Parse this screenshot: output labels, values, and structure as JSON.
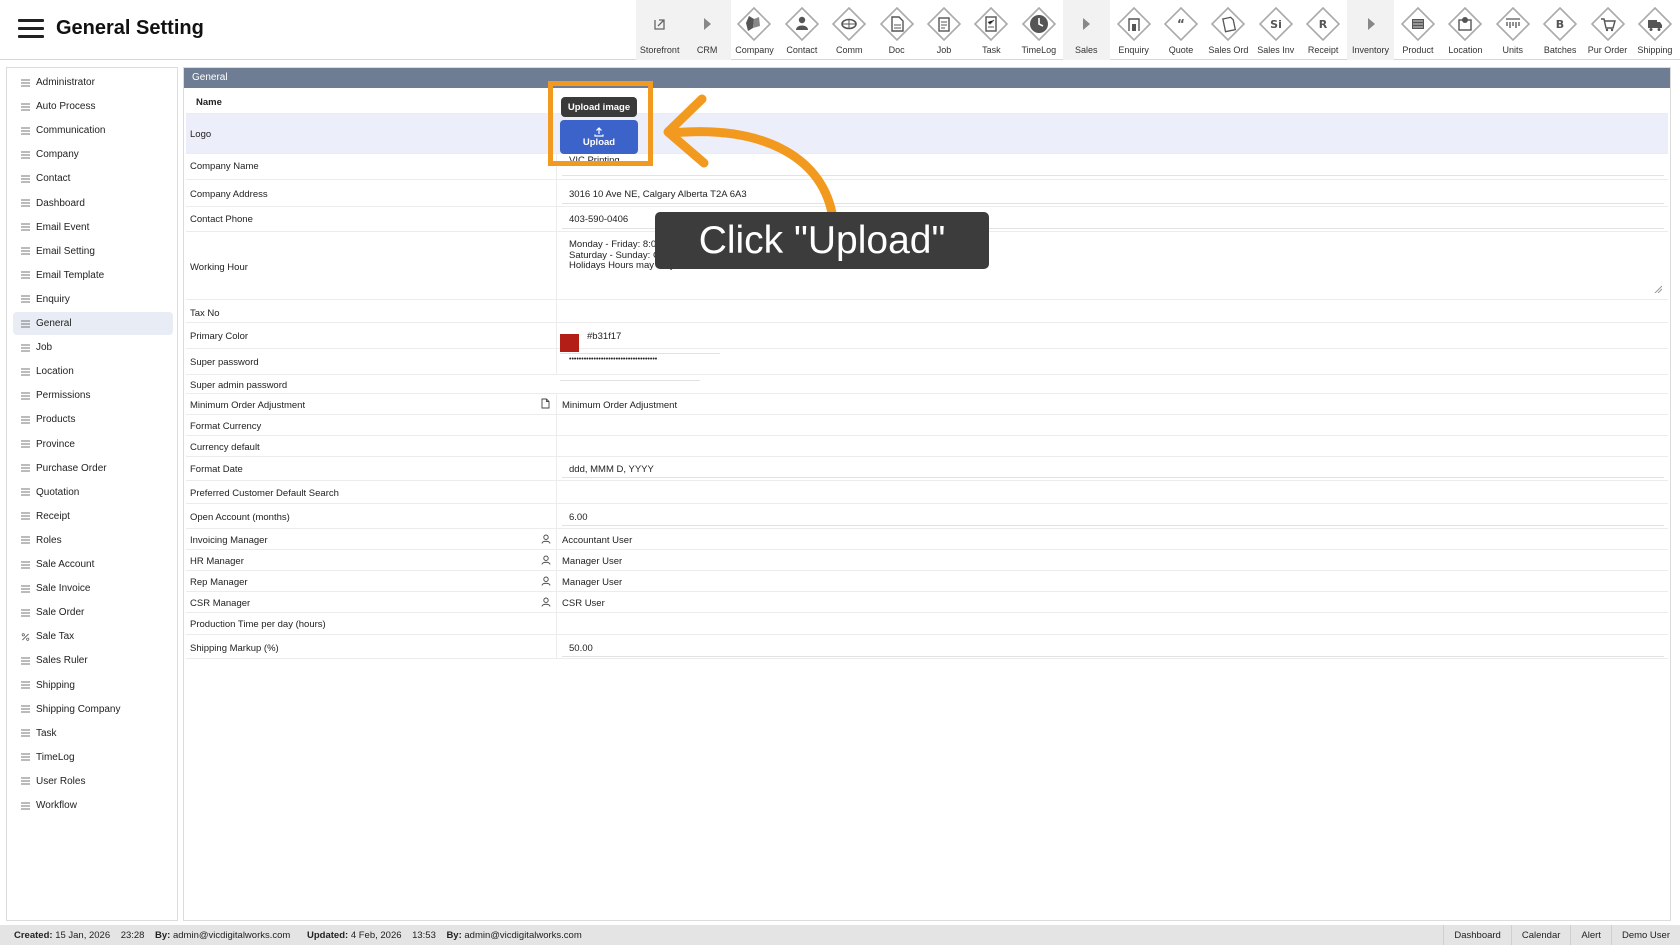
{
  "header": {
    "title": "General Setting"
  },
  "toolbar": [
    {
      "label": "Storefront",
      "icon": "external-link-icon",
      "shaded": true
    },
    {
      "label": "CRM",
      "icon": "chevron-right-icon",
      "shaded": true
    },
    {
      "label": "Company",
      "icon": "company-icon",
      "shaded": false
    },
    {
      "label": "Contact",
      "icon": "contact-icon",
      "shaded": false
    },
    {
      "label": "Comm",
      "icon": "comm-icon",
      "shaded": false
    },
    {
      "label": "Doc",
      "icon": "doc-icon",
      "shaded": false
    },
    {
      "label": "Job",
      "icon": "job-icon",
      "shaded": false
    },
    {
      "label": "Task",
      "icon": "task-icon",
      "shaded": false
    },
    {
      "label": "TimeLog",
      "icon": "clock-icon",
      "shaded": false
    },
    {
      "label": "Sales",
      "icon": "chevron-right-icon",
      "shaded": true
    },
    {
      "label": "Enquiry",
      "icon": "enquiry-icon",
      "shaded": false
    },
    {
      "label": "Quote",
      "icon": "quote-icon",
      "shaded": false
    },
    {
      "label": "Sales Ord",
      "icon": "sales-order-icon",
      "shaded": false
    },
    {
      "label": "Sales Inv",
      "icon": "sales-invoice-icon",
      "glyph": "Si",
      "shaded": false
    },
    {
      "label": "Receipt",
      "icon": "receipt-icon",
      "glyph": "R",
      "shaded": false
    },
    {
      "label": "Inventory",
      "icon": "chevron-right-icon",
      "shaded": true
    },
    {
      "label": "Product",
      "icon": "product-icon",
      "shaded": false
    },
    {
      "label": "Location",
      "icon": "location-icon",
      "shaded": false
    },
    {
      "label": "Units",
      "icon": "units-icon",
      "shaded": false
    },
    {
      "label": "Batches",
      "icon": "batches-icon",
      "glyph": "B",
      "shaded": false
    },
    {
      "label": "Pur Order",
      "icon": "cart-icon",
      "shaded": false
    },
    {
      "label": "Shipping",
      "icon": "truck-icon",
      "shaded": false
    }
  ],
  "sidebar": {
    "items": [
      {
        "label": "Administrator",
        "icon": "list-icon"
      },
      {
        "label": "Auto Process",
        "icon": "list-icon"
      },
      {
        "label": "Communication",
        "icon": "list-icon"
      },
      {
        "label": "Company",
        "icon": "list-icon"
      },
      {
        "label": "Contact",
        "icon": "list-icon"
      },
      {
        "label": "Dashboard",
        "icon": "list-icon"
      },
      {
        "label": "Email Event",
        "icon": "list-icon"
      },
      {
        "label": "Email Setting",
        "icon": "list-icon"
      },
      {
        "label": "Email Template",
        "icon": "list-icon"
      },
      {
        "label": "Enquiry",
        "icon": "list-icon"
      },
      {
        "label": "General",
        "icon": "list-icon",
        "active": true
      },
      {
        "label": "Job",
        "icon": "list-icon"
      },
      {
        "label": "Location",
        "icon": "list-icon"
      },
      {
        "label": "Permissions",
        "icon": "list-icon"
      },
      {
        "label": "Products",
        "icon": "list-icon"
      },
      {
        "label": "Province",
        "icon": "list-icon"
      },
      {
        "label": "Purchase Order",
        "icon": "list-icon"
      },
      {
        "label": "Quotation",
        "icon": "list-icon"
      },
      {
        "label": "Receipt",
        "icon": "list-icon"
      },
      {
        "label": "Roles",
        "icon": "list-icon"
      },
      {
        "label": "Sale Account",
        "icon": "list-icon"
      },
      {
        "label": "Sale Invoice",
        "icon": "list-icon"
      },
      {
        "label": "Sale Order",
        "icon": "list-icon"
      },
      {
        "label": "Sale Tax",
        "icon": "percent-icon"
      },
      {
        "label": "Sales Ruler",
        "icon": "list-icon"
      },
      {
        "label": "Shipping",
        "icon": "list-icon"
      },
      {
        "label": "Shipping Company",
        "icon": "list-icon"
      },
      {
        "label": "Task",
        "icon": "list-icon"
      },
      {
        "label": "TimeLog",
        "icon": "list-icon"
      },
      {
        "label": "User Roles",
        "icon": "list-icon"
      },
      {
        "label": "Workflow",
        "icon": "list-icon"
      }
    ]
  },
  "panel": {
    "title": "General",
    "fields": {
      "name": "Name",
      "logo": "Logo",
      "company_name": {
        "label": "Company Name",
        "value": "VIC Printing"
      },
      "company_address": {
        "label": "Company Address",
        "value": "3016 10 Ave NE, Calgary Alberta T2A 6A3"
      },
      "contact_phone": {
        "label": "Contact Phone",
        "value": "403-590-0406"
      },
      "working_hour": {
        "label": "Working Hour",
        "lines": [
          "Monday - Friday: 8:00AM - 05:00PM",
          "Saturday - Sunday: Closed",
          "Holidays Hours may vary"
        ]
      },
      "tax_no": {
        "label": "Tax No"
      },
      "primary_color": {
        "label": "Primary Color",
        "value": "#b31f17"
      },
      "super_password": {
        "label": "Super password",
        "value": "••••••••••••••••••••••••••••••••••••"
      },
      "super_admin_password": {
        "label": "Super admin password"
      },
      "min_order_adjustment": {
        "label": "Minimum Order Adjustment",
        "value": "Minimum Order Adjustment"
      },
      "format_currency": {
        "label": "Format Currency"
      },
      "currency_default": {
        "label": "Currency default"
      },
      "format_date": {
        "label": "Format Date",
        "value": "ddd, MMM D, YYYY"
      },
      "preferred_customer_search": {
        "label": "Preferred Customer Default Search"
      },
      "open_account": {
        "label": "Open Account (months)",
        "value": "6.00"
      },
      "invoicing_manager": {
        "label": "Invoicing Manager",
        "value": "Accountant User"
      },
      "hr_manager": {
        "label": "HR Manager",
        "value": "Manager User"
      },
      "rep_manager": {
        "label": "Rep Manager",
        "value": "Manager User"
      },
      "csr_manager": {
        "label": "CSR Manager",
        "value": "CSR User"
      },
      "production_time": {
        "label": "Production Time per day (hours)"
      },
      "shipping_markup": {
        "label": "Shipping Markup (%)",
        "value": "50.00"
      }
    },
    "upload": {
      "tooltip": "Upload image",
      "label": "Upload"
    }
  },
  "callout": {
    "text": "Click \"Upload\"",
    "accent": "#f29a1f"
  },
  "footer": {
    "created_label": "Created:",
    "created_date": "15 Jan, 2026",
    "created_time": "23:28",
    "by_label": "By:",
    "created_by": "admin@vicdigitalworks.com",
    "updated_label": "Updated:",
    "updated_date": "4 Feb, 2026",
    "updated_time": "13:53",
    "updated_by": "admin@vicdigitalworks.com",
    "links": [
      "Dashboard",
      "Calendar",
      "Alert",
      "Demo User"
    ]
  }
}
